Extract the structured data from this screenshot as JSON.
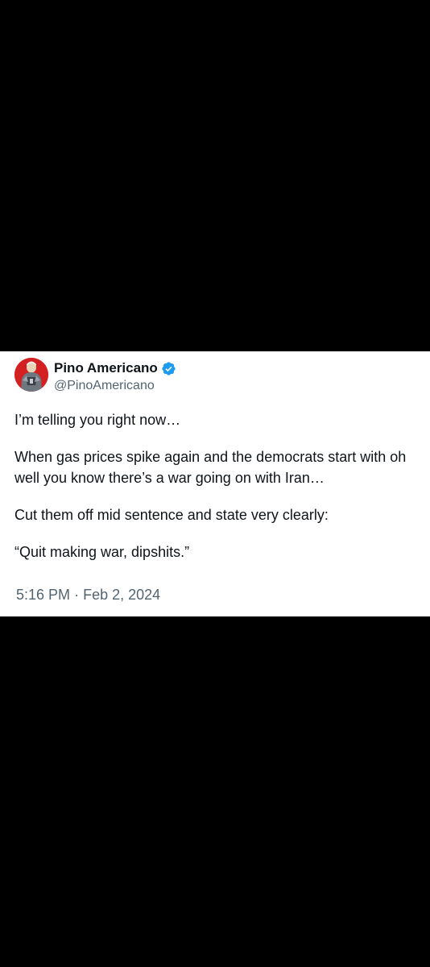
{
  "tweet": {
    "author": {
      "display_name": "Pino Americano",
      "handle": "@PinoAmericano",
      "verified": true,
      "verified_color": "#1d9bf0"
    },
    "paragraphs": [
      "I’m telling you right now…",
      "When gas prices spike again and the democrats start with oh well you know there’s a war going on with Iran…",
      "Cut them off mid sentence and state very clearly:",
      "“Quit making war, dipshits.”"
    ],
    "time": "5:16 PM",
    "separator": "·",
    "date": "Feb 2, 2024"
  },
  "colors": {
    "background": "#000000",
    "card": "#ffffff",
    "text_primary": "#0f1419",
    "text_secondary": "#536471",
    "avatar_bg": "#d32020"
  },
  "icons": {
    "verified": "verified-badge-icon",
    "avatar": "avatar-image"
  }
}
